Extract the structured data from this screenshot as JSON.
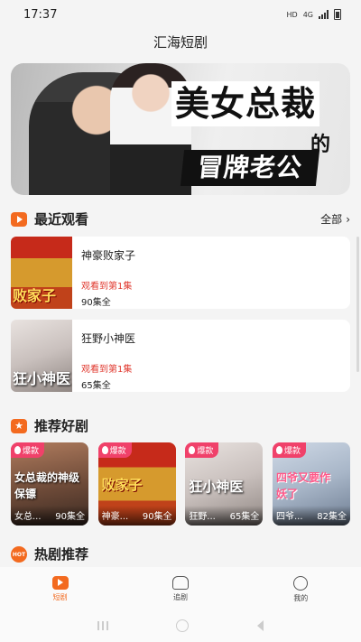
{
  "status": {
    "time": "17:37",
    "hd": "HD",
    "net": "4G"
  },
  "app": {
    "title": "汇海短剧"
  },
  "banner": {
    "title_line1": "美女总裁",
    "title_de": "的",
    "title_line2": "冒牌老公"
  },
  "recent": {
    "title": "最近观看",
    "more": "全部",
    "items": [
      {
        "name": "神豪败家子",
        "progress": "观看到第1集",
        "episodes": "90集全",
        "poster_text": "败家子"
      },
      {
        "name": "狂野小神医",
        "progress": "观看到第1集",
        "episodes": "65集全",
        "poster_text": "狂小神医"
      }
    ]
  },
  "recommend": {
    "title": "推荐好剧",
    "items": [
      {
        "badge": "爆款",
        "art": "女总裁的神级保镖",
        "name": "女总...",
        "episodes": "90集全"
      },
      {
        "badge": "爆款",
        "art": "败家子",
        "name": "神豪...",
        "episodes": "90集全"
      },
      {
        "badge": "爆款",
        "art": "狂小神医",
        "name": "狂野...",
        "episodes": "65集全"
      },
      {
        "badge": "爆款",
        "art": "四爷又要作妖了",
        "name": "四爷...",
        "episodes": "82集全"
      }
    ]
  },
  "hot": {
    "title": "热剧推荐",
    "icon_text": "HOT"
  },
  "tabs": [
    {
      "label": "短剧",
      "active": true
    },
    {
      "label": "追剧",
      "active": false
    },
    {
      "label": "我的",
      "active": false
    }
  ],
  "colors": {
    "accent": "#f36a1f",
    "badge": "#f0416a",
    "progress": "#e0382e"
  }
}
